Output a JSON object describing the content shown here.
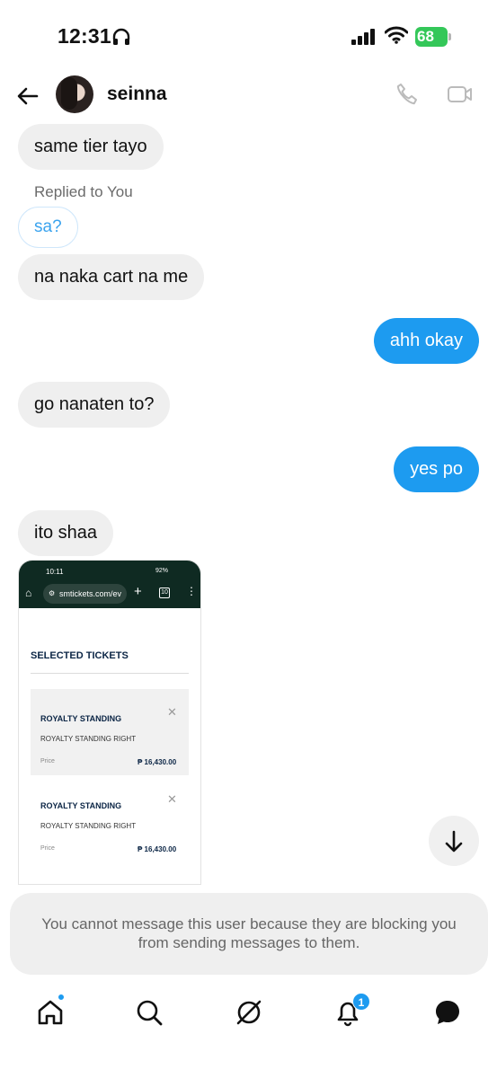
{
  "status_bar": {
    "time": "12:31",
    "battery_percent": "68",
    "icons": [
      "headphones-icon",
      "signal-icon",
      "wifi-icon",
      "battery-icon"
    ]
  },
  "header": {
    "username": "seinna",
    "icons": [
      "back-arrow-icon",
      "avatar",
      "phone-icon",
      "video-camera-icon"
    ]
  },
  "messages": [
    {
      "side": "in",
      "text": "same tier tayo"
    },
    {
      "side": "reply_context",
      "label": "Replied to You",
      "quoted": "sa?"
    },
    {
      "side": "in",
      "text": "na naka cart na me"
    },
    {
      "side": "out",
      "text": "ahh okay"
    },
    {
      "side": "in",
      "text": "go nanaten to?"
    },
    {
      "side": "out",
      "text": "yes po"
    },
    {
      "side": "in",
      "text": "ito shaa"
    }
  ],
  "shared_image": {
    "time": "10:11",
    "status": "92%",
    "url": "smtickets.com/ev",
    "tab_count": "10",
    "heading": "SELECTED TICKETS",
    "tickets": [
      {
        "name": "ROYALTY STANDING",
        "section": "ROYALTY STANDING RIGHT",
        "price_label": "Price",
        "price": "₱ 16,430.00"
      },
      {
        "name": "ROYALTY STANDING",
        "section": "ROYALTY STANDING RIGHT",
        "price_label": "Price",
        "price": "₱ 16,430.00"
      }
    ]
  },
  "blocked_notice": "You cannot message this user because they are blocking you from sending messages to them.",
  "bottom_nav": {
    "items": [
      "home-icon",
      "search-icon",
      "explore-icon",
      "notifications-icon",
      "messages-icon"
    ],
    "notification_count": "1"
  },
  "colors": {
    "outgoing_bubble": "#1d9bf0",
    "incoming_bubble": "#efefef",
    "battery": "#34c759"
  }
}
